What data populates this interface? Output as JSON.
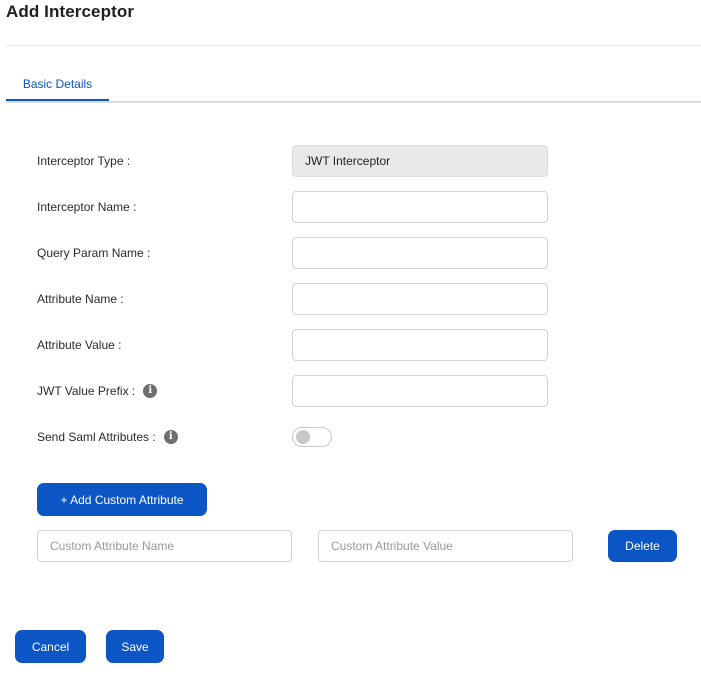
{
  "page": {
    "title": "Add Interceptor"
  },
  "tabs": [
    {
      "label": "Basic Details",
      "active": true
    }
  ],
  "form": {
    "interceptor_type": {
      "label": "Interceptor Type :",
      "value": "JWT Interceptor"
    },
    "interceptor_name": {
      "label": "Interceptor Name :",
      "value": ""
    },
    "query_param_name": {
      "label": "Query Param Name :",
      "value": ""
    },
    "attribute_name": {
      "label": "Attribute Name :",
      "value": ""
    },
    "attribute_value": {
      "label": "Attribute Value :",
      "value": ""
    },
    "jwt_value_prefix": {
      "label": "JWT Value Prefix :",
      "value": "",
      "info_icon": "info-icon"
    },
    "send_saml_attributes": {
      "label": "Send Saml Attributes :",
      "enabled": false,
      "info_icon": "info-icon"
    }
  },
  "custom_attributes": {
    "add_button_label": "+ Add Custom Attribute",
    "name_placeholder": "Custom Attribute Name",
    "value_placeholder": "Custom Attribute Value",
    "delete_button_label": "Delete"
  },
  "footer": {
    "cancel_label": "Cancel",
    "save_label": "Save"
  },
  "colors": {
    "primary": "#0b55c4",
    "readonly_background": "#e8e9eb",
    "info_icon": "#6f6f6f"
  }
}
